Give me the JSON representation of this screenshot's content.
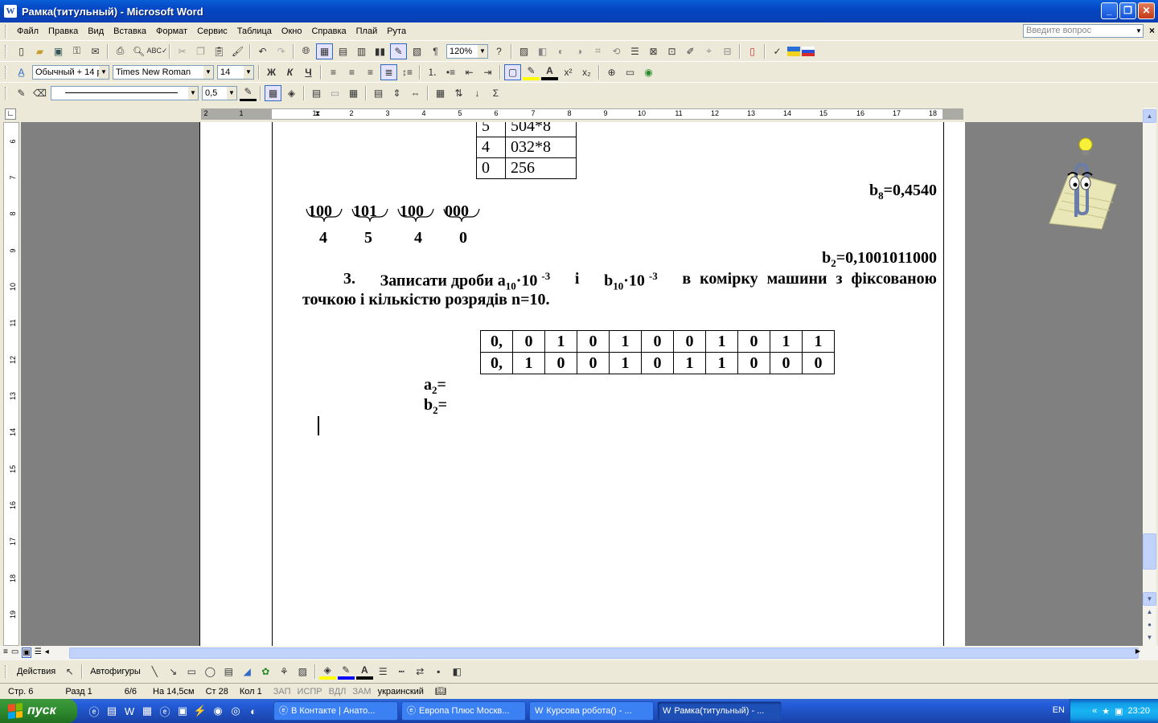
{
  "window": {
    "title": "Рамка(титульный) - Microsoft Word",
    "app_icon": "W"
  },
  "menu": [
    "Файл",
    "Правка",
    "Вид",
    "Вставка",
    "Формат",
    "Сервис",
    "Таблица",
    "Окно",
    "Справка",
    "Плай",
    "Рута"
  ],
  "help_box_placeholder": "Введите вопрос",
  "toolbar": {
    "zoom": "120%",
    "style": "Обычный + 14 р",
    "font": "Times New Roman",
    "font_size": "14",
    "line_width": "0,5",
    "bold_label": "Ж",
    "italic_label": "К",
    "underline_label": "Ч"
  },
  "ruler": {
    "h_numbers": [
      "2",
      "1",
      "1",
      "2",
      "3",
      "4",
      "5",
      "6",
      "7",
      "8",
      "9",
      "10",
      "11",
      "12",
      "13",
      "14",
      "15",
      "16",
      "17",
      "18"
    ],
    "v_numbers": [
      "6",
      "7",
      "8",
      "9",
      "10",
      "11",
      "12",
      "13",
      "14",
      "15",
      "16",
      "17",
      "18",
      "19"
    ]
  },
  "document": {
    "conv_table": [
      [
        "5",
        "504*8"
      ],
      [
        "4",
        "032*8"
      ],
      [
        "0",
        "256"
      ]
    ],
    "b8": {
      "var": "b",
      "sub": "8",
      "rest": "=0,4540"
    },
    "groups": [
      "100",
      "101",
      "100",
      "000"
    ],
    "group_digits": [
      "4",
      "5",
      "4",
      "0"
    ],
    "b2": {
      "var": "b",
      "sub": "2",
      "rest": "=0,1001011000"
    },
    "task3_line1": {
      "num": "3.",
      "p1": "Записати дроби a",
      "s1": "10",
      "p2": "·10",
      "e1": "-3",
      "p3": "і",
      "p4": "b",
      "s2": "10",
      "p5": "·10",
      "e2": "-3",
      "p6": "в комірку машини з фіксованою"
    },
    "task3_line2": "точкою і кількістю розрядів n=10.",
    "bits_rows": [
      [
        "0,",
        "0",
        "1",
        "0",
        "1",
        "0",
        "0",
        "1",
        "0",
        "1",
        "1"
      ],
      [
        "0,",
        "1",
        "0",
        "0",
        "1",
        "0",
        "1",
        "1",
        "0",
        "0",
        "0"
      ]
    ],
    "a2_label": {
      "var": "a",
      "sub": "2",
      "rest": "="
    },
    "b2_label": {
      "var": "b",
      "sub": "2",
      "rest": "="
    }
  },
  "drawing_toolbar": {
    "actions": "Действия",
    "autoshapes": "Автофигуры"
  },
  "status": {
    "page": "Стр. 6",
    "section": "Разд 1",
    "pages": "6/6",
    "at": "На 14,5см",
    "line": "Ст 28",
    "col": "Кол 1",
    "rec": "ЗАП",
    "trk": "ИСПР",
    "ext": "ВДЛ",
    "ovr": "ЗАМ",
    "lang": "украинский"
  },
  "taskbar": {
    "start": "пуск",
    "tasks": [
      {
        "label": "В Контакте | Анато...",
        "icon": "ie-icon"
      },
      {
        "label": "Европа Плюс Москв...",
        "icon": "ie-icon"
      },
      {
        "label": "Курсова робота() - ...",
        "icon": "word-icon"
      },
      {
        "label": "Рамка(титульный) - ...",
        "icon": "word-icon"
      }
    ],
    "lang": "EN",
    "clock": "23:20"
  },
  "colors": {
    "titlebar": "#0a5fd8",
    "taskbar": "#245edb",
    "start": "#2f8a2f",
    "doc_bg": "#808080"
  }
}
